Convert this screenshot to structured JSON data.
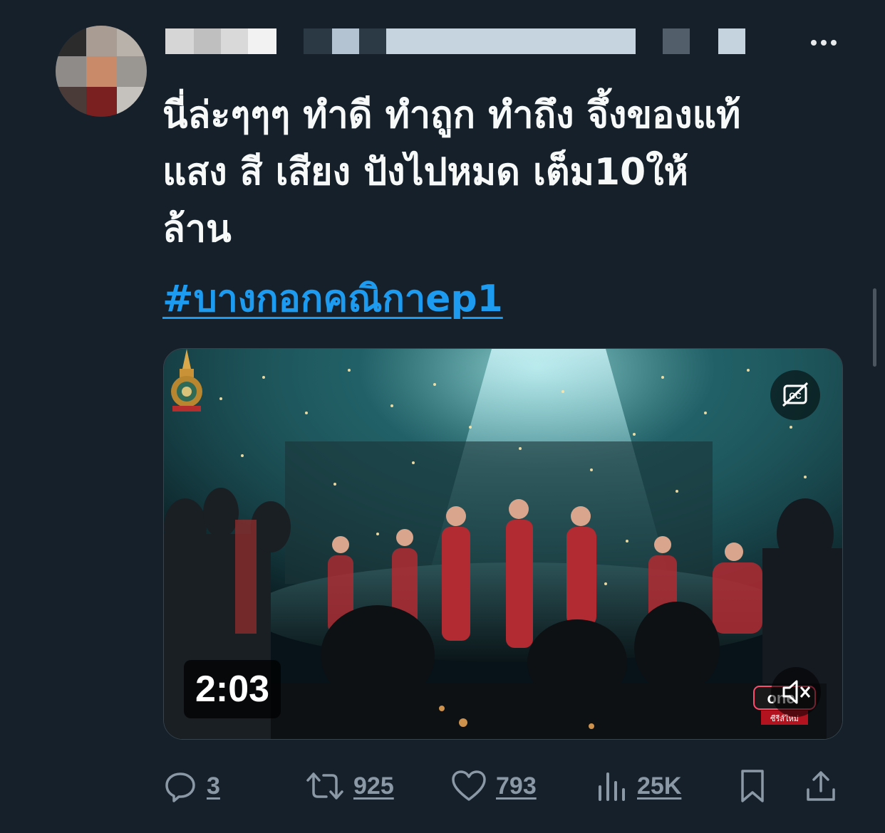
{
  "tweet": {
    "text_lines": [
      "นี่ล่ะๆๆๆ ทำดี ทำถูก ทำถึง จึ้งของแท้",
      "แสง สี เสียง ปังไปหมด เต็ม10ให้",
      "ล้าน"
    ],
    "hashtag": "#บางกอกคณิกาep1"
  },
  "media": {
    "duration": "2:03",
    "channel_logo_text": "one",
    "channel_logo_sub": "ซีรีส์ใหม่"
  },
  "actions": {
    "replies": "3",
    "retweets": "925",
    "likes": "793",
    "views": "25K"
  },
  "colors": {
    "background": "#15202b",
    "accent": "#1d9bf0",
    "muted": "#8b98a5",
    "text": "#f7f9f9"
  },
  "icons": {
    "more": "more-icon",
    "reply": "reply-icon",
    "retweet": "retweet-icon",
    "like": "heart-icon",
    "views": "views-icon",
    "bookmark": "bookmark-icon",
    "share": "share-icon",
    "cc": "captions-icon",
    "mute": "muted-speaker-icon"
  }
}
